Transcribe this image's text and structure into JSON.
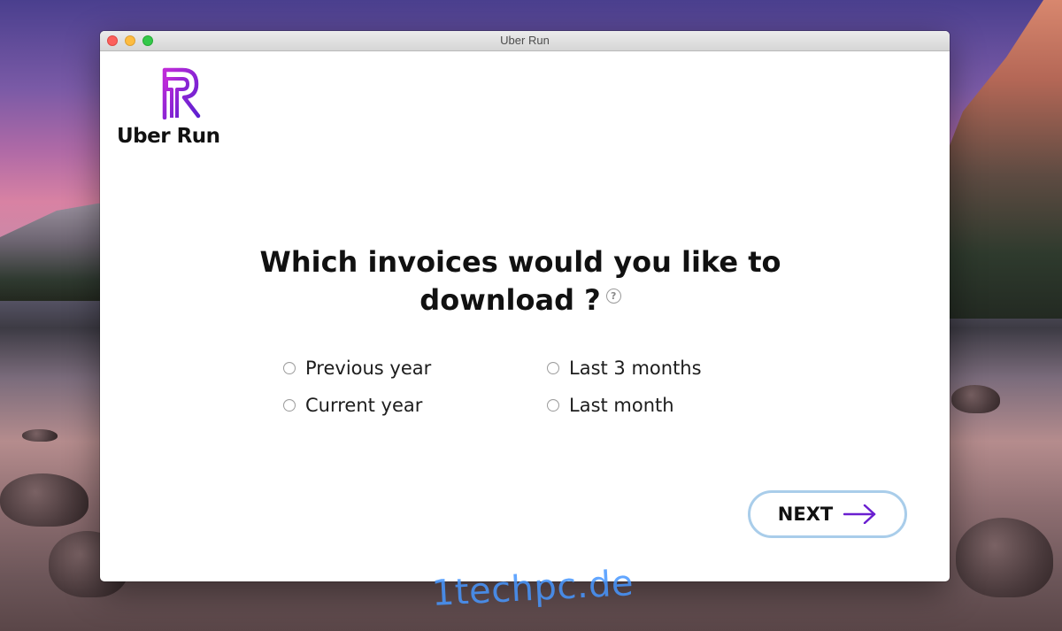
{
  "window": {
    "title": "Uber Run"
  },
  "app": {
    "logo_text": "Uber Run"
  },
  "question": {
    "line1": "Which invoices would you like to",
    "line2": "download ?",
    "help_icon": "question-circle-icon",
    "help_glyph": "?"
  },
  "options": [
    {
      "label": "Previous year",
      "selected": false
    },
    {
      "label": "Last 3 months",
      "selected": false
    },
    {
      "label": "Current year",
      "selected": false
    },
    {
      "label": "Last month",
      "selected": false
    }
  ],
  "next_button": {
    "label": "NEXT",
    "icon": "arrow-right-icon"
  },
  "watermark": {
    "text": "1techpc.de"
  },
  "colors": {
    "brand_purple": "#6a1fd0",
    "brand_magenta": "#c02bd8",
    "button_border": "#a9cdea",
    "traffic_close": "#fc605c",
    "traffic_min": "#fdbc40",
    "traffic_max": "#34c84a"
  }
}
